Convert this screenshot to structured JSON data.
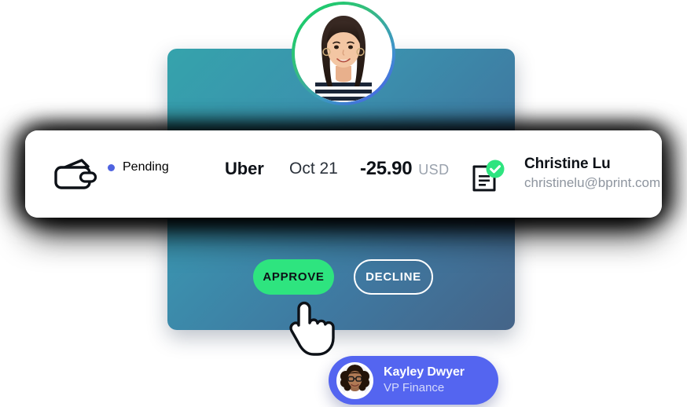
{
  "transaction": {
    "wallet_icon": "wallet-icon",
    "status_dot_color": "#4f63e0",
    "status_label": "Pending",
    "merchant": "Uber",
    "date": "Oct 21",
    "amount": "-25.90",
    "currency": "USD",
    "receipt_icon": "document-icon",
    "receipt_verified_icon": "check-circle-icon",
    "verified_color": "#2ee47f",
    "person_name": "Christine Lu",
    "person_email": "christinelu@bprint.com"
  },
  "actions": {
    "approve_label": "APPROVE",
    "decline_label": "DECLINE",
    "approve_color": "#2ee47f"
  },
  "panel": {
    "gradient_from": "#35a3ac",
    "gradient_to": "#456488"
  },
  "avatar": {
    "ring_gradient_from": "#17c973",
    "ring_gradient_to": "#5560ea",
    "alt": "avatar-christine-lu"
  },
  "cursor": {
    "icon": "hand-pointer-cursor"
  },
  "approver_chip": {
    "name": "Kayley Dwyer",
    "role": "VP Finance",
    "background": "#5465f0",
    "avatar_alt": "avatar-kayley-dwyer"
  }
}
